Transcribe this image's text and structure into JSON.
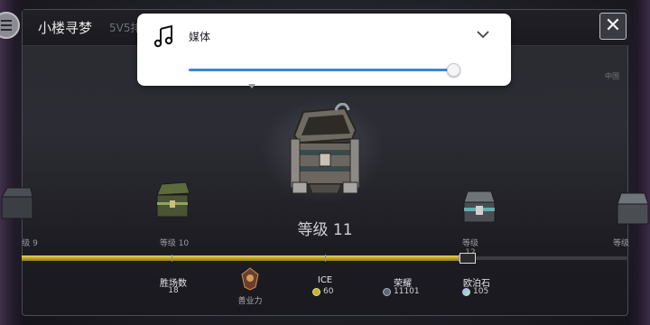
{
  "header": {
    "title": "小楼寻梦",
    "subtitle": "5V5排",
    "region": "中国",
    "close_glyph": "✕"
  },
  "volume_popup": {
    "label": "媒体",
    "icon": "music-note-icon",
    "expand_icon": "chevron-down-icon",
    "volume_level": 0.99
  },
  "chests": {
    "center_level": "等级 11",
    "items": [
      {
        "label": "级 9"
      },
      {
        "label": "等级 10"
      },
      {
        "label": "等级 12"
      },
      {
        "label": "等级"
      }
    ]
  },
  "progress": {
    "fill_fraction": 0.725
  },
  "stats": {
    "wins_label": "胜场数",
    "wins_value": "18",
    "karma_label": "善业力",
    "ice_label": "ICE",
    "ice_value": "60",
    "honor_label": "荣耀",
    "honor_value": "11101",
    "opal_label": "欧泊石",
    "opal_value": "105"
  },
  "colors": {
    "accent_blue": "#3a86d8",
    "progress_gold": "#e2cf52",
    "popup_bg": "#ffffff"
  }
}
